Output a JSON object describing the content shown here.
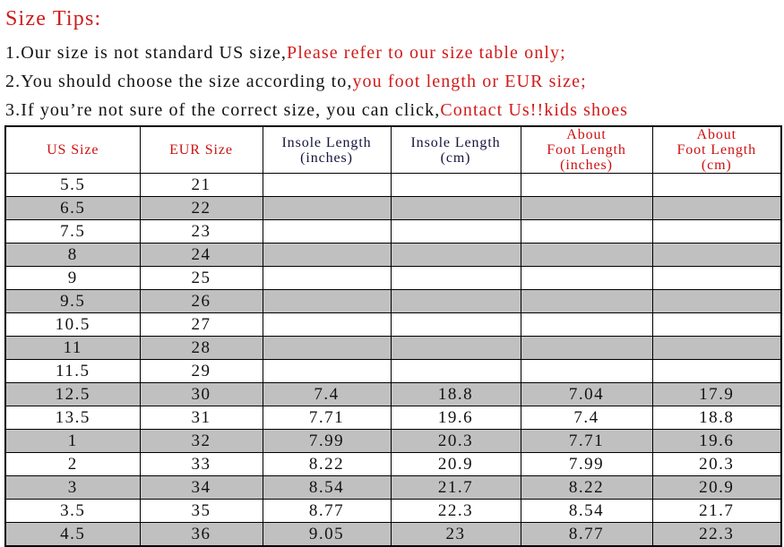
{
  "tips": {
    "title": "Size Tips:",
    "lines": [
      {
        "number": "1.",
        "black": "Our size is not standard US size,",
        "red": "Please refer to our size table only;"
      },
      {
        "number": "2.",
        "black": "You should choose the size according to,",
        "red": "you foot length or EUR size;"
      },
      {
        "number": "3.",
        "black": "If you’re not sure of the correct size, you can click,",
        "red": "Contact Us!!kids shoes"
      }
    ]
  },
  "colors": {
    "red_text": "#d11a1a",
    "header_red": "#cc1111",
    "header_dark": "#14143c",
    "row_shaded": "#c0c0c0",
    "row_plain": "#ffffff",
    "border": "#000000",
    "body_text": "#121212"
  },
  "table": {
    "headers": [
      {
        "lines": [
          "US Size"
        ],
        "color": "red"
      },
      {
        "lines": [
          "EUR Size"
        ],
        "color": "red"
      },
      {
        "lines": [
          "Insole Length",
          "(inches)"
        ],
        "color": "dark"
      },
      {
        "lines": [
          "Insole Length",
          "(cm)"
        ],
        "color": "dark"
      },
      {
        "lines": [
          "About",
          "Foot Length",
          "(inches)"
        ],
        "color": "red"
      },
      {
        "lines": [
          "About",
          "Foot Length",
          "(cm)"
        ],
        "color": "red"
      }
    ],
    "rows": [
      {
        "us": "5.5",
        "eur": "21",
        "insole_in": "",
        "insole_cm": "",
        "foot_in": "",
        "foot_cm": ""
      },
      {
        "us": "6.5",
        "eur": "22",
        "insole_in": "",
        "insole_cm": "",
        "foot_in": "",
        "foot_cm": ""
      },
      {
        "us": "7.5",
        "eur": "23",
        "insole_in": "",
        "insole_cm": "",
        "foot_in": "",
        "foot_cm": ""
      },
      {
        "us": "8",
        "eur": "24",
        "insole_in": "",
        "insole_cm": "",
        "foot_in": "",
        "foot_cm": ""
      },
      {
        "us": "9",
        "eur": "25",
        "insole_in": "",
        "insole_cm": "",
        "foot_in": "",
        "foot_cm": ""
      },
      {
        "us": "9.5",
        "eur": "26",
        "insole_in": "",
        "insole_cm": "",
        "foot_in": "",
        "foot_cm": ""
      },
      {
        "us": "10.5",
        "eur": "27",
        "insole_in": "",
        "insole_cm": "",
        "foot_in": "",
        "foot_cm": ""
      },
      {
        "us": "11",
        "eur": "28",
        "insole_in": "",
        "insole_cm": "",
        "foot_in": "",
        "foot_cm": ""
      },
      {
        "us": "11.5",
        "eur": "29",
        "insole_in": "",
        "insole_cm": "",
        "foot_in": "",
        "foot_cm": ""
      },
      {
        "us": "12.5",
        "eur": "30",
        "insole_in": "7.4",
        "insole_cm": "18.8",
        "foot_in": "7.04",
        "foot_cm": "17.9"
      },
      {
        "us": "13.5",
        "eur": "31",
        "insole_in": "7.71",
        "insole_cm": "19.6",
        "foot_in": "7.4",
        "foot_cm": "18.8"
      },
      {
        "us": "1",
        "eur": "32",
        "insole_in": "7.99",
        "insole_cm": "20.3",
        "foot_in": "7.71",
        "foot_cm": "19.6"
      },
      {
        "us": "2",
        "eur": "33",
        "insole_in": "8.22",
        "insole_cm": "20.9",
        "foot_in": "7.99",
        "foot_cm": "20.3"
      },
      {
        "us": "3",
        "eur": "34",
        "insole_in": "8.54",
        "insole_cm": "21.7",
        "foot_in": "8.22",
        "foot_cm": "20.9"
      },
      {
        "us": "3.5",
        "eur": "35",
        "insole_in": "8.77",
        "insole_cm": "22.3",
        "foot_in": "8.54",
        "foot_cm": "21.7"
      },
      {
        "us": "4.5",
        "eur": "36",
        "insole_in": "9.05",
        "insole_cm": "23",
        "foot_in": "8.77",
        "foot_cm": "22.3"
      }
    ]
  }
}
